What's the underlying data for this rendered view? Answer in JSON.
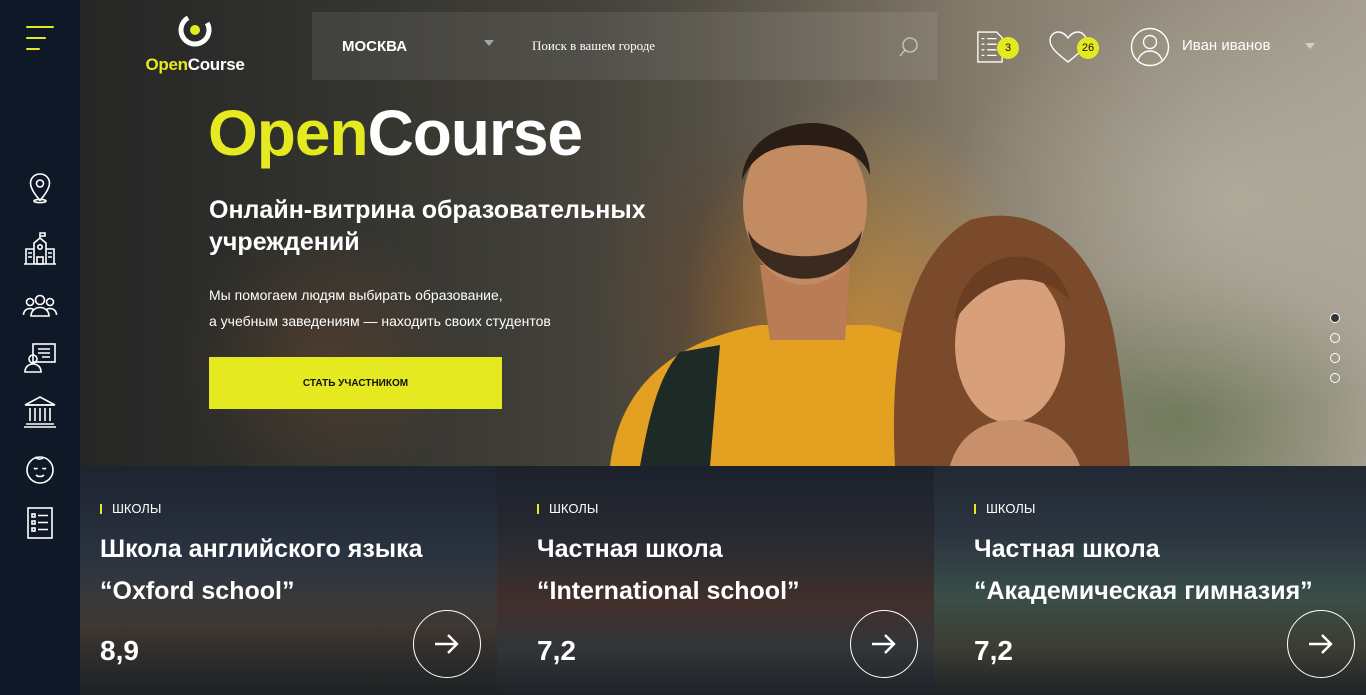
{
  "header": {
    "logo_open": "Open",
    "logo_course": "Course",
    "city": "МОСКВА",
    "search_placeholder": "Поиск в вашем городе",
    "compare_count": "3",
    "favorites_count": "26",
    "user_name": "Иван иванов"
  },
  "sidebar": {
    "items": [
      "location-pin-icon",
      "school-icon",
      "people-icon",
      "teacher-icon",
      "university-icon",
      "baby-icon",
      "list-icon"
    ]
  },
  "hero": {
    "title_open": "Open",
    "title_course": "Course",
    "subtitle": "Онлайн-витрина образовательных учреждений",
    "desc_line1": "Мы помогаем людям выбирать образование,",
    "desc_line2": "а учебным заведениям — находить своих студентов",
    "cta_label": "СТАТЬ УЧАСТНИКОМ",
    "slides_total": 4,
    "slide_active": 1
  },
  "cards": [
    {
      "tag": "ШКОЛЫ",
      "title_line1": "Школа английского языка",
      "title_line2": "“Oxford school”",
      "rating": "8,9"
    },
    {
      "tag": "ШКОЛЫ",
      "title_line1": "Частная школа",
      "title_line2": "“International school”",
      "rating": "7,2"
    },
    {
      "tag": "ШКОЛЫ",
      "title_line1": "Частная школа",
      "title_line2": "“Академическая гимназия”",
      "rating": "7,2"
    }
  ],
  "colors": {
    "accent": "#e4e920",
    "sidebar": "#0f1826"
  }
}
